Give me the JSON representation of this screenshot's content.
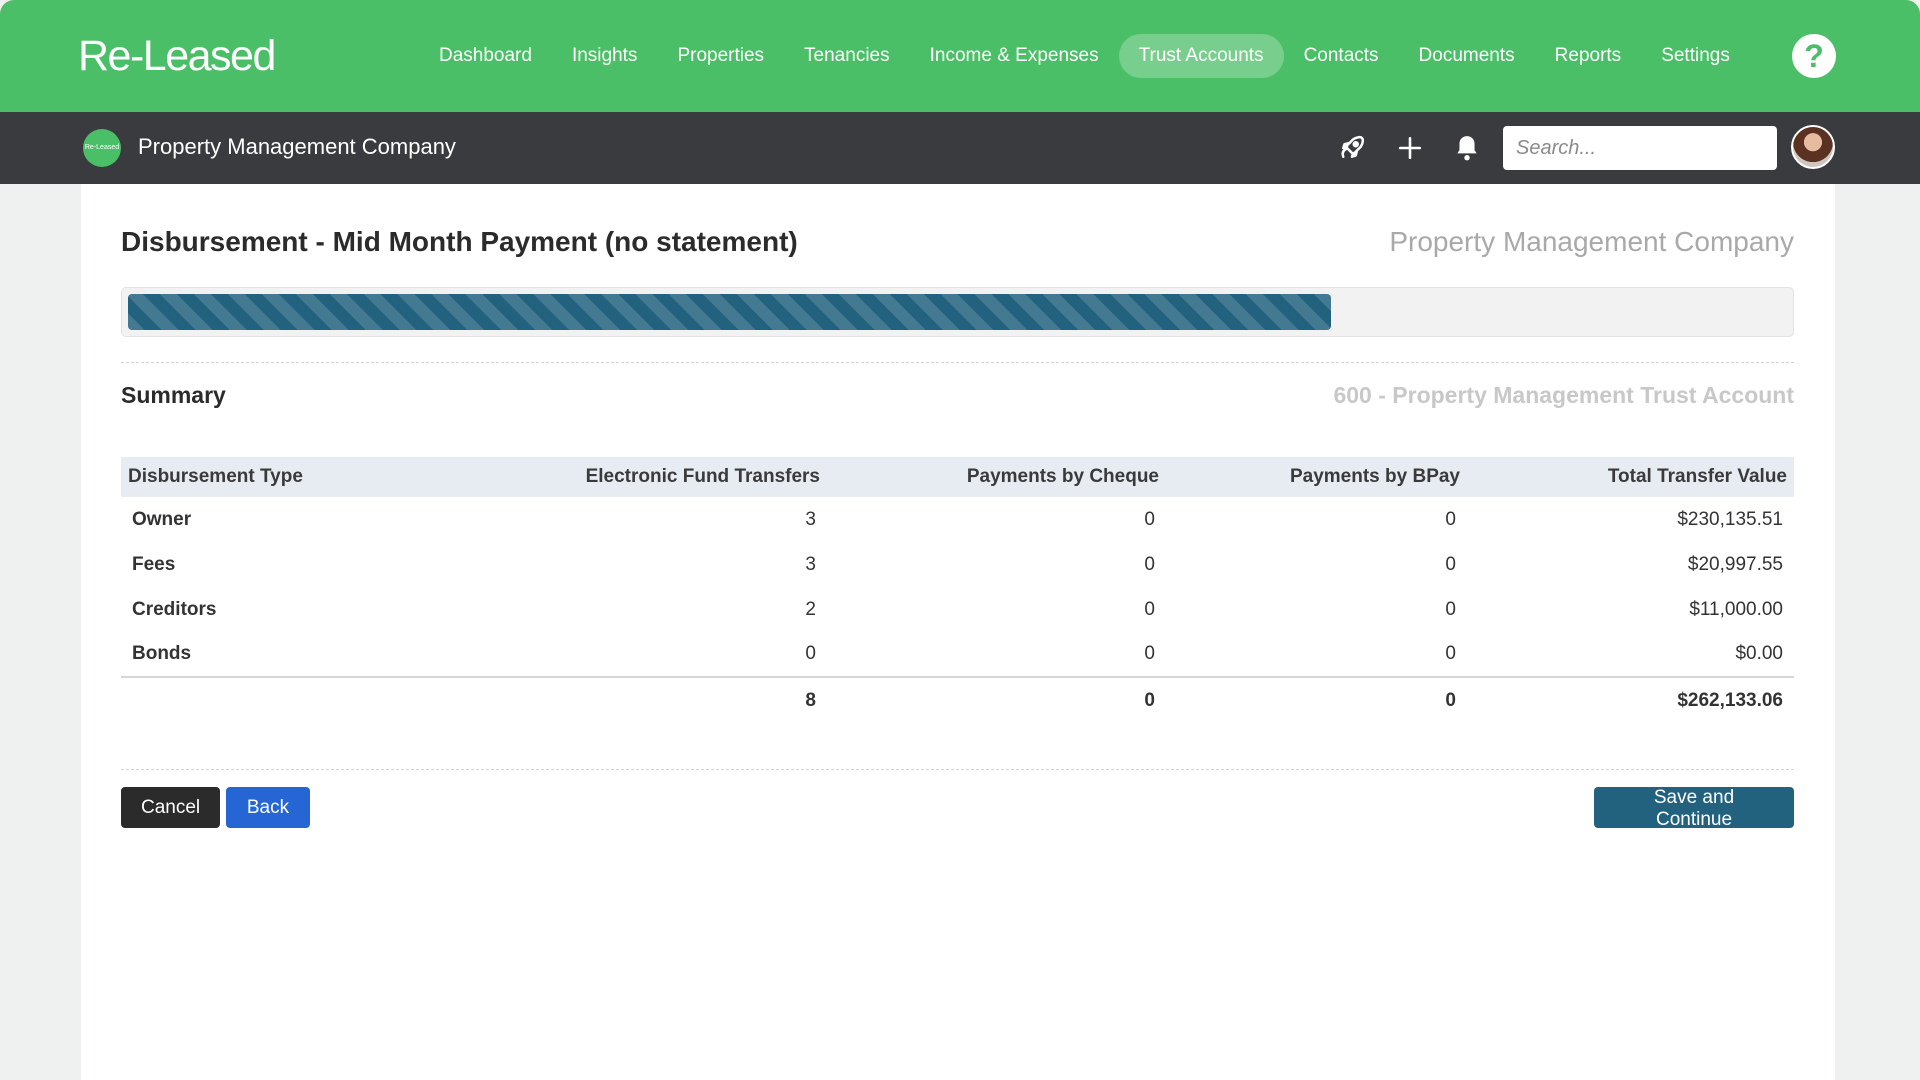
{
  "app": {
    "logo_text": "Re-Leased"
  },
  "nav": {
    "items": [
      {
        "label": "Dashboard"
      },
      {
        "label": "Insights"
      },
      {
        "label": "Properties"
      },
      {
        "label": "Tenancies"
      },
      {
        "label": "Income & Expenses"
      },
      {
        "label": "Trust Accounts",
        "active": true
      },
      {
        "label": "Contacts"
      },
      {
        "label": "Documents"
      },
      {
        "label": "Reports"
      },
      {
        "label": "Settings"
      }
    ],
    "help_label": "?"
  },
  "subbar": {
    "badge_text": "Re-Leased",
    "company_name": "Property Management Company",
    "icons": [
      "rocket-icon",
      "plus-icon",
      "bell-icon"
    ],
    "search_placeholder": "Search..."
  },
  "page": {
    "title": "Disbursement - Mid Month Payment (no statement)",
    "company": "Property Management Company",
    "progress_fraction": 0.725
  },
  "summary": {
    "title": "Summary",
    "account": "600 - Property Management Trust Account",
    "columns": [
      "Disbursement Type",
      "Electronic Fund Transfers",
      "Payments by Cheque",
      "Payments by BPay",
      "Total Transfer Value"
    ],
    "rows": [
      [
        "Owner",
        "3",
        "0",
        "0",
        "$230,135.51"
      ],
      [
        "Fees",
        "3",
        "0",
        "0",
        "$20,997.55"
      ],
      [
        "Creditors",
        "2",
        "0",
        "0",
        "$11,000.00"
      ],
      [
        "Bonds",
        "0",
        "0",
        "0",
        "$0.00"
      ]
    ],
    "total": [
      "",
      "8",
      "0",
      "0",
      "$262,133.06"
    ]
  },
  "actions": {
    "cancel": "Cancel",
    "back": "Back",
    "save": "Save and Continue"
  },
  "colors": {
    "brand_green": "#4bbf67",
    "dark_bar": "#3a3b3f",
    "progress": "#23627f",
    "back_button": "#2566d4"
  }
}
